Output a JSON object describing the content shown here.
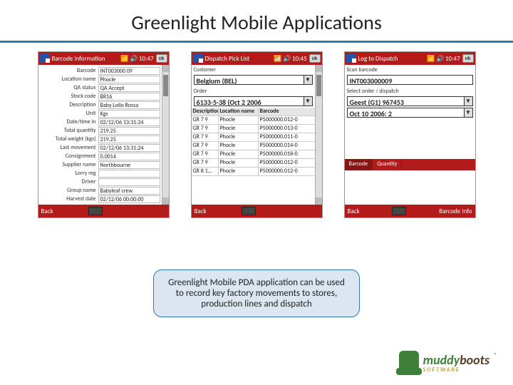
{
  "title": "Greenlight Mobile Applications",
  "callout": "Greenlight Mobile PDA application can be used to record key factory movements to stores, production lines and dispatch",
  "logo": {
    "word1": "muddy",
    "word2": "boots",
    "sub": "SOFTWARE",
    "reg": "®"
  },
  "pda1": {
    "titlebar": {
      "title": "Barcode information",
      "time": "10:47",
      "ok": "ok"
    },
    "rows": [
      {
        "lbl": "Barcode",
        "val": "INT003000 09"
      },
      {
        "lbl": "Location name",
        "val": "Phocle"
      },
      {
        "lbl": "QA status",
        "val": "QA Accept"
      },
      {
        "lbl": "Stock code",
        "val": "BR16"
      },
      {
        "lbl": "Description",
        "val": "Baby Lollo Rossa"
      },
      {
        "lbl": "Unit",
        "val": "Kgs"
      },
      {
        "lbl": "Date/time in",
        "val": "02/12/06 13:31:24"
      },
      {
        "lbl": "Total quantity",
        "val": "219.25"
      },
      {
        "lbl": "Total weight (kgs)",
        "val": "219.25"
      },
      {
        "lbl": "Last movement",
        "val": "02/12/06 13:31:24"
      },
      {
        "lbl": "Consignment",
        "val": "0.0014"
      },
      {
        "lbl": "Supplier name",
        "val": "Northbourne"
      },
      {
        "lbl": "Lorry reg",
        "val": ""
      },
      {
        "lbl": "Driver",
        "val": ""
      },
      {
        "lbl": "Group name",
        "val": "Babyleaf crew"
      },
      {
        "lbl": "Harvest date",
        "val": "02/12/06 00:00:00"
      }
    ],
    "bottom": {
      "back": "Back"
    }
  },
  "pda2": {
    "titlebar": {
      "title": "Dispatch Pick List",
      "time": "10:45",
      "ok": "ok"
    },
    "customer_label": "Customer",
    "customer_value": "Belgium (BEL)",
    "order_label": "Order",
    "order_value": "6133-5-38 (Oct  2 2006",
    "grid": {
      "headers": [
        "Description",
        "Location name",
        "Barcode"
      ],
      "rows": [
        [
          "GR 7 9",
          "Phocle",
          "P5000000.012-0"
        ],
        [
          "GR 7 9",
          "Phocle",
          "P5000000.013-0"
        ],
        [
          "GR 7 9",
          "Phocle",
          "P5000000.011-0"
        ],
        [
          "GR 7 9",
          "Phocle",
          "P5000000.014-0"
        ],
        [
          "GR 7 9",
          "Phocle",
          "P5000000.018-0"
        ],
        [
          "GR 7 9",
          "Phocle",
          "P5000000.012-0"
        ],
        [
          "GR 8 1…",
          "Phocle",
          "P5000000.012-0"
        ]
      ]
    },
    "bottom": {
      "back": "Back"
    }
  },
  "pda3": {
    "titlebar": {
      "title": "Log to Dispatch",
      "time": "10:47",
      "ok": "ok"
    },
    "scan_label": "Scan barcode",
    "scan_value": "INT003000009",
    "select_label": "Select order / dispatch",
    "select_value": "Geest (G1) 967453",
    "date_value": "Oct 10 2006: 2",
    "tabs": [
      "Barcode",
      "Quantity"
    ],
    "bottom": {
      "back": "Back",
      "info": "Barcode Info"
    }
  }
}
